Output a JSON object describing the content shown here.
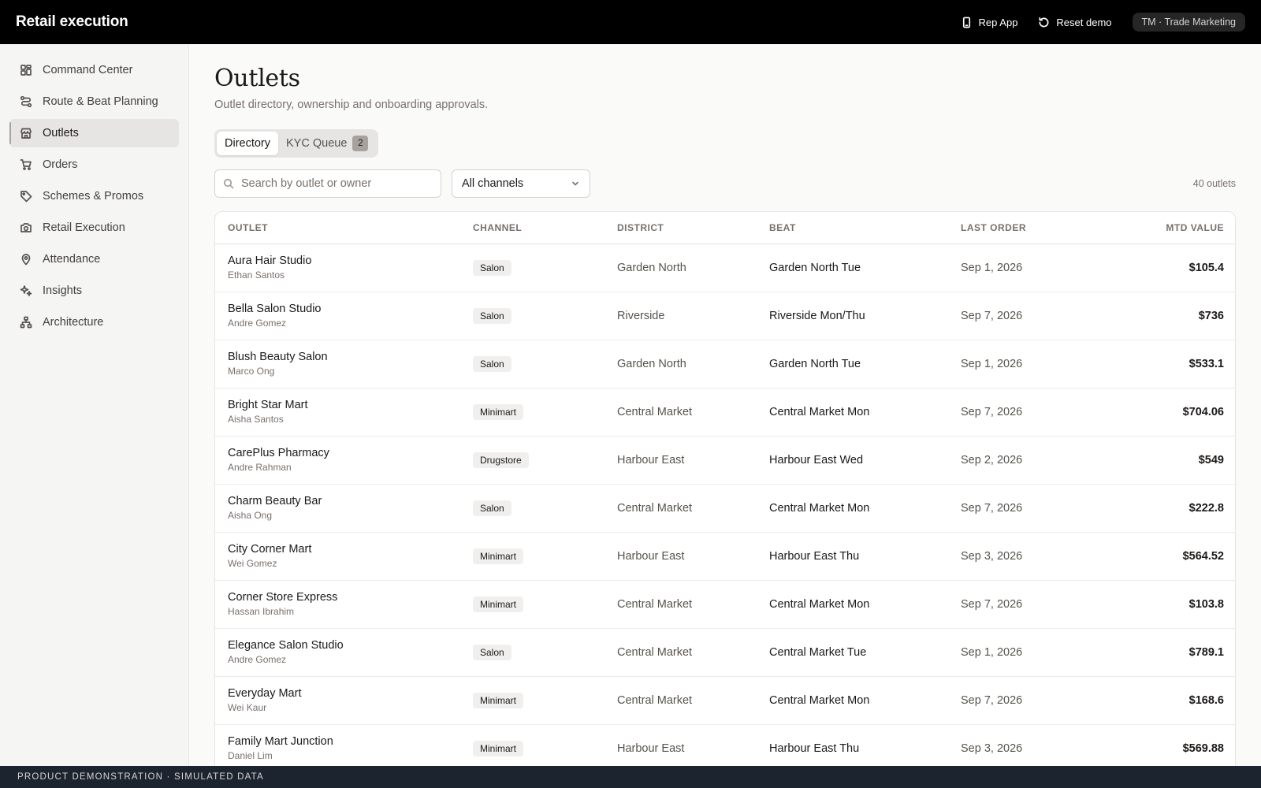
{
  "app": {
    "title": "Retail execution"
  },
  "header": {
    "rep_app": "Rep App",
    "reset_demo": "Reset demo",
    "user": "TM · Trade Marketing"
  },
  "sidebar": {
    "items": [
      {
        "label": "Command Center",
        "icon": "dashboard-icon"
      },
      {
        "label": "Route & Beat Planning",
        "icon": "route-icon"
      },
      {
        "label": "Outlets",
        "icon": "store-icon",
        "active": true
      },
      {
        "label": "Orders",
        "icon": "cart-icon"
      },
      {
        "label": "Schemes & Promos",
        "icon": "tag-icon"
      },
      {
        "label": "Retail Execution",
        "icon": "camera-icon"
      },
      {
        "label": "Attendance",
        "icon": "location-pin-icon"
      },
      {
        "label": "Insights",
        "icon": "sparkles-icon"
      },
      {
        "label": "Architecture",
        "icon": "network-icon"
      }
    ]
  },
  "page": {
    "title": "Outlets",
    "subtitle": "Outlet directory, ownership and onboarding approvals.",
    "tabs": {
      "directory": "Directory",
      "kyc": "KYC Queue",
      "kyc_count": "2"
    },
    "search": {
      "placeholder": "Search by outlet or owner",
      "value": ""
    },
    "channel_filter": {
      "selected": "All channels"
    },
    "count": "40 outlets"
  },
  "table": {
    "columns": [
      "Outlet",
      "Channel",
      "District",
      "Beat",
      "Last order",
      "MTD value"
    ],
    "rows": [
      {
        "name": "Aura Hair Studio",
        "owner": "Ethan Santos",
        "channel": "Salon",
        "district": "Garden North",
        "beat": "Garden North Tue",
        "last_order": "Sep 1, 2026",
        "mtd": "$105.4"
      },
      {
        "name": "Bella Salon Studio",
        "owner": "Andre Gomez",
        "channel": "Salon",
        "district": "Riverside",
        "beat": "Riverside Mon/Thu",
        "last_order": "Sep 7, 2026",
        "mtd": "$736"
      },
      {
        "name": "Blush Beauty Salon",
        "owner": "Marco Ong",
        "channel": "Salon",
        "district": "Garden North",
        "beat": "Garden North Tue",
        "last_order": "Sep 1, 2026",
        "mtd": "$533.1"
      },
      {
        "name": "Bright Star Mart",
        "owner": "Aisha Santos",
        "channel": "Minimart",
        "district": "Central Market",
        "beat": "Central Market Mon",
        "last_order": "Sep 7, 2026",
        "mtd": "$704.06"
      },
      {
        "name": "CarePlus Pharmacy",
        "owner": "Andre Rahman",
        "channel": "Drugstore",
        "district": "Harbour East",
        "beat": "Harbour East Wed",
        "last_order": "Sep 2, 2026",
        "mtd": "$549"
      },
      {
        "name": "Charm Beauty Bar",
        "owner": "Aisha Ong",
        "channel": "Salon",
        "district": "Central Market",
        "beat": "Central Market Mon",
        "last_order": "Sep 7, 2026",
        "mtd": "$222.8"
      },
      {
        "name": "City Corner Mart",
        "owner": "Wei Gomez",
        "channel": "Minimart",
        "district": "Harbour East",
        "beat": "Harbour East Thu",
        "last_order": "Sep 3, 2026",
        "mtd": "$564.52"
      },
      {
        "name": "Corner Store Express",
        "owner": "Hassan Ibrahim",
        "channel": "Minimart",
        "district": "Central Market",
        "beat": "Central Market Mon",
        "last_order": "Sep 7, 2026",
        "mtd": "$103.8"
      },
      {
        "name": "Elegance Salon Studio",
        "owner": "Andre Gomez",
        "channel": "Salon",
        "district": "Central Market",
        "beat": "Central Market Tue",
        "last_order": "Sep 1, 2026",
        "mtd": "$789.1"
      },
      {
        "name": "Everyday Mart",
        "owner": "Wei Kaur",
        "channel": "Minimart",
        "district": "Central Market",
        "beat": "Central Market Mon",
        "last_order": "Sep 7, 2026",
        "mtd": "$168.6"
      },
      {
        "name": "Family Mart Junction",
        "owner": "Daniel Lim",
        "channel": "Minimart",
        "district": "Harbour East",
        "beat": "Harbour East Thu",
        "last_order": "Sep 3, 2026",
        "mtd": "$569.88"
      }
    ]
  },
  "footer": {
    "text": "PRODUCT DEMONSTRATION · SIMULATED DATA"
  }
}
